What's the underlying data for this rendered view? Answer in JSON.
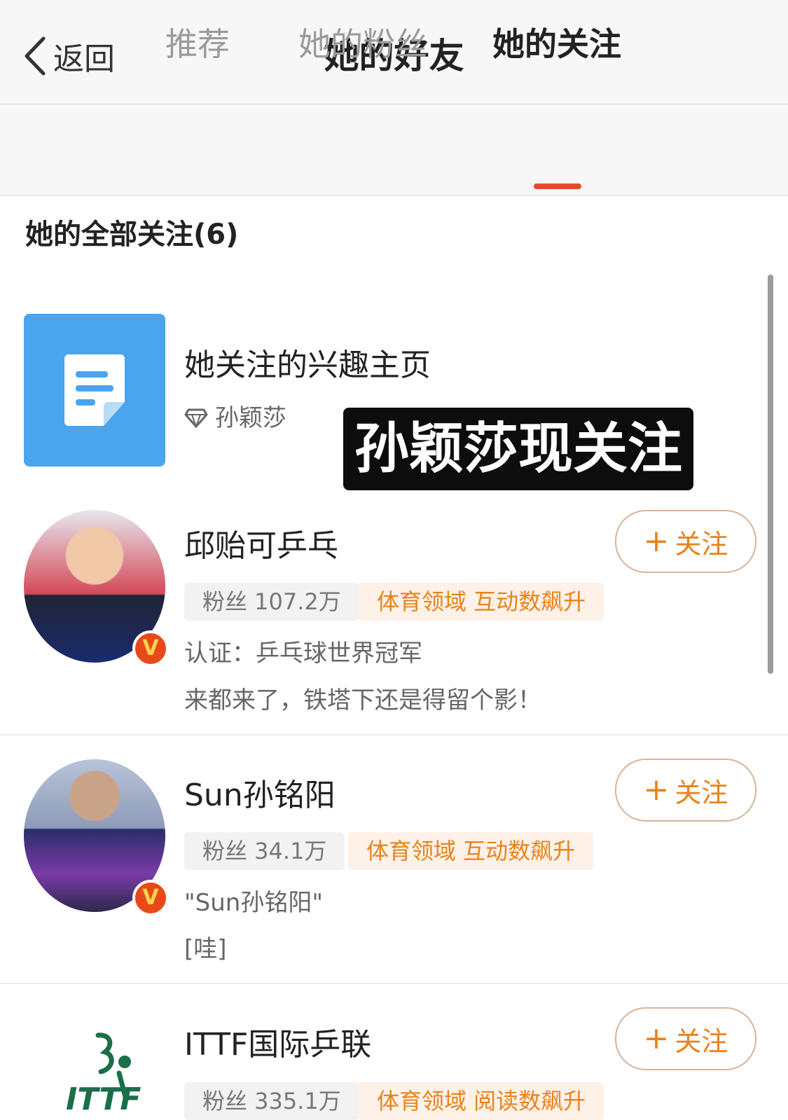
{
  "header": {
    "back_label": "返回",
    "title": "她的好友"
  },
  "tabs": [
    {
      "label": "推荐",
      "active": false
    },
    {
      "label": "她的粉丝",
      "active": false
    },
    {
      "label": "她的关注",
      "active": true
    }
  ],
  "section_title": "她的全部关注(6)",
  "interest_card": {
    "title": "她关注的兴趣主页",
    "owner_name": "孙颖莎",
    "icon": "document-icon"
  },
  "overlay_caption": "孙颖莎现关注",
  "follow_label": "关注",
  "users": [
    {
      "name": "邱贻可乒乓",
      "fans": "粉丝 107.2万",
      "tag": "体育领域 互动数飙升",
      "verified_text": "认证：乒乓球世界冠军",
      "bio": "来都来了，铁塔下还是得留个影！"
    },
    {
      "name": "Sun孙铭阳",
      "fans": "粉丝 34.1万",
      "tag": "体育领域 互动数飙升",
      "verified_text": "\"Sun孙铭阳\"",
      "bio": "[哇]"
    },
    {
      "name": "ITTF国际乒联",
      "fans": "粉丝 335.1万",
      "tag": "体育领域 阅读数飙升",
      "logo_text": "ITTF"
    }
  ],
  "colors": {
    "accent": "#e8831a",
    "tab_indicator": "#e8492a",
    "doc_tile": "#4aa5ee"
  }
}
